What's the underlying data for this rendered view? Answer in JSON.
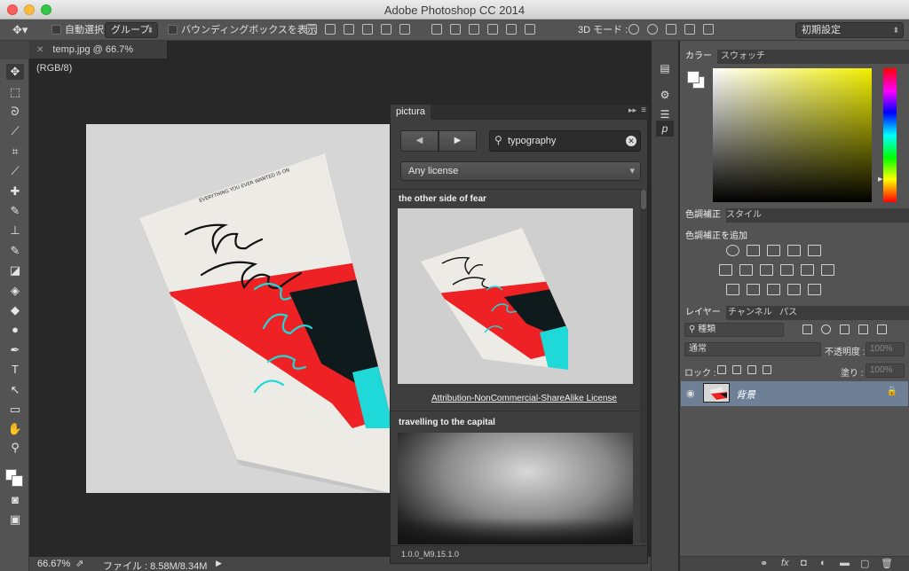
{
  "window": {
    "title": "Adobe Photoshop CC 2014"
  },
  "options_bar": {
    "auto_select_label": "自動選択 :",
    "auto_select_value": "グループ",
    "transform_label": "バウンディングボックスを表示",
    "mode_3d_label": "3D モード :",
    "workspace_value": "初期設定"
  },
  "document": {
    "tab_label": "temp.jpg @ 66.7% (RGB/8)",
    "zoom": "66.67%",
    "file_info": "ファイル : 8.58M/8.34M"
  },
  "artwork": {
    "tagline": "EVERYTHING YOU EVER WANTED IS ON",
    "script_text": "The other side of fear",
    "colors": {
      "paper": "#ecebe6",
      "red": "#ee2225",
      "cyan": "#1ed9d8",
      "dark": "#0e1a1c"
    }
  },
  "pictura": {
    "tab_label": "pictura",
    "search_value": "typography",
    "license_filter": "Any license",
    "results": [
      {
        "title": "the other side of fear",
        "license": "Attribution-NonCommercial-ShareAlike License"
      },
      {
        "title": "travelling to the capital"
      }
    ],
    "version": "1.0.0_M9.15.1.0"
  },
  "color_panel": {
    "tabs": [
      "カラー",
      "スウォッチ"
    ]
  },
  "adjustments_panel": {
    "tabs": [
      "色調補正",
      "スタイル"
    ],
    "caption": "色調補正を追加"
  },
  "layers_panel": {
    "tabs": [
      "レイヤー",
      "チャンネル",
      "パス"
    ],
    "filter_value": "種類",
    "blend_mode": "通常",
    "opacity_label": "不透明度 :",
    "opacity_value": "100%",
    "lock_label": "ロック :",
    "fill_label": "塗り :",
    "fill_value": "100%",
    "layers": [
      {
        "name": "背景"
      }
    ]
  }
}
